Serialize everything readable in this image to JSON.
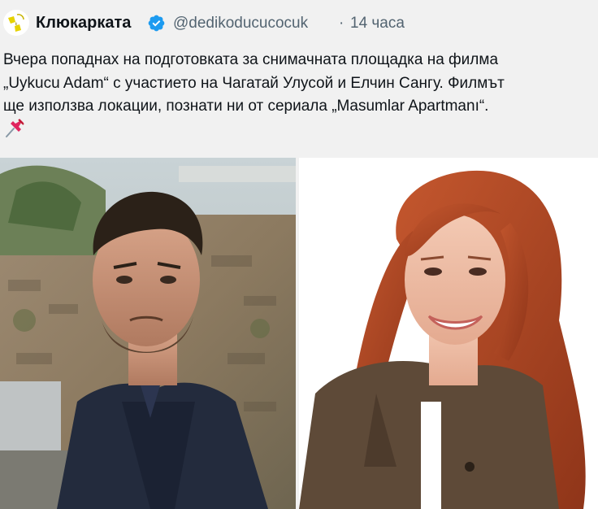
{
  "tweet": {
    "author_name": "Клюкарката",
    "handle": "@dedikoducucocuk",
    "separator": "·",
    "time": "14 часа",
    "text_lines": [
      "Вчера попаднах на подготовката за снимачната площадка на филма",
      "„Uykucu Adam“ с участието на Чагатай Улусой и Елчин Сангу. Филмът",
      "ще използва локации, познати ни от сериала „Masumlar Apartmanı“."
    ],
    "emoji": "pushpin-icon"
  },
  "icons": {
    "avatar": "logo-avatar",
    "verified": "verified-badge-icon"
  },
  "colors": {
    "background": "#f1f1f1",
    "verified": "#1d9bf0",
    "secondary_text": "#536471",
    "primary_text": "#0f1419"
  },
  "media": {
    "left_photo": "man-in-dark-coat-photo",
    "right_photo": "smiling-red-haired-woman-photo"
  }
}
